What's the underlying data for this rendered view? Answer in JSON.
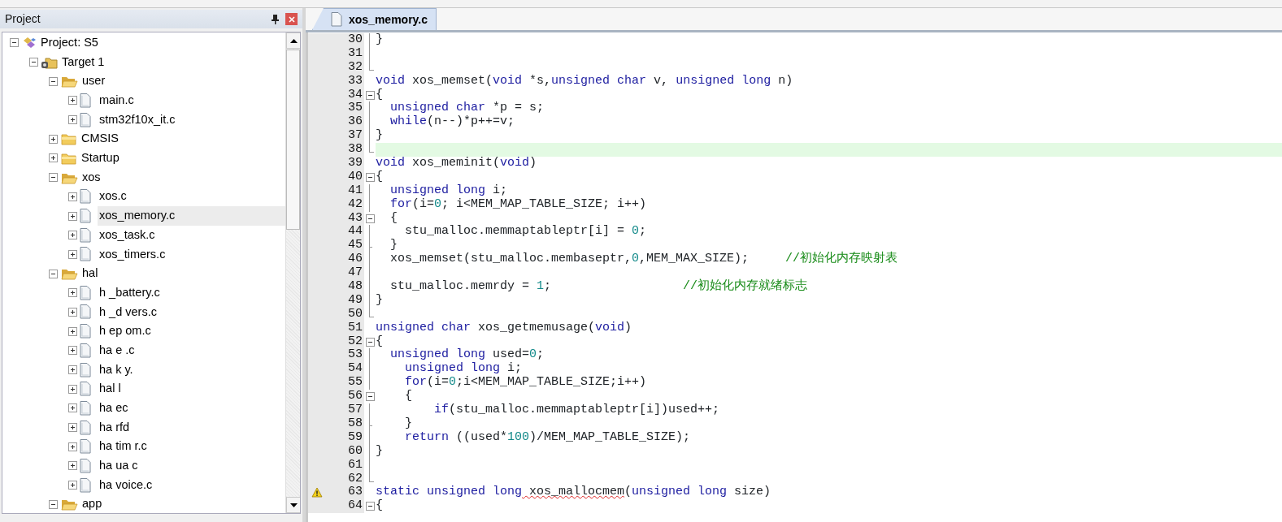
{
  "project_panel": {
    "title": "Project",
    "tree": [
      {
        "label": "Project: S5",
        "kind": "project",
        "expanded": true,
        "selected": false,
        "children": [
          {
            "label": "Target 1",
            "kind": "target",
            "expanded": true,
            "selected": false,
            "children": [
              {
                "label": "user",
                "kind": "folder",
                "expanded": true,
                "selected": false,
                "children": [
                  {
                    "label": "main.c",
                    "kind": "file",
                    "expanded": false,
                    "selected": false
                  },
                  {
                    "label": "stm32f10x_it.c",
                    "kind": "file",
                    "expanded": false,
                    "selected": false
                  }
                ]
              },
              {
                "label": "CMSIS",
                "kind": "folder",
                "expanded": false,
                "selected": false
              },
              {
                "label": "Startup",
                "kind": "folder",
                "expanded": false,
                "selected": false
              },
              {
                "label": "xos",
                "kind": "folder",
                "expanded": true,
                "selected": false,
                "children": [
                  {
                    "label": "xos.c",
                    "kind": "file",
                    "expanded": false,
                    "selected": false
                  },
                  {
                    "label": "xos_memory.c",
                    "kind": "file",
                    "expanded": false,
                    "selected": true
                  },
                  {
                    "label": "xos_task.c",
                    "kind": "file",
                    "expanded": false,
                    "selected": false
                  },
                  {
                    "label": "xos_timers.c",
                    "kind": "file",
                    "expanded": false,
                    "selected": false
                  }
                ]
              },
              {
                "label": "hal",
                "kind": "folder",
                "expanded": true,
                "selected": false,
                "children": [
                  {
                    "label": "h _battery.c",
                    "kind": "file",
                    "expanded": false,
                    "selected": false
                  },
                  {
                    "label": "h _d vers.c",
                    "kind": "file",
                    "expanded": false,
                    "selected": false
                  },
                  {
                    "label": "h ep om.c",
                    "kind": "file",
                    "expanded": false,
                    "selected": false
                  },
                  {
                    "label": "ha e .c",
                    "kind": "file",
                    "expanded": false,
                    "selected": false
                  },
                  {
                    "label": "ha k y.",
                    "kind": "file",
                    "expanded": false,
                    "selected": false
                  },
                  {
                    "label": "hal l",
                    "kind": "file",
                    "expanded": false,
                    "selected": false
                  },
                  {
                    "label": "ha ec",
                    "kind": "file",
                    "expanded": false,
                    "selected": false
                  },
                  {
                    "label": "ha rfd",
                    "kind": "file",
                    "expanded": false,
                    "selected": false
                  },
                  {
                    "label": "ha tim r.c",
                    "kind": "file",
                    "expanded": false,
                    "selected": false
                  },
                  {
                    "label": "ha ua c",
                    "kind": "file",
                    "expanded": false,
                    "selected": false
                  },
                  {
                    "label": "ha voice.c",
                    "kind": "file",
                    "expanded": false,
                    "selected": false
                  }
                ]
              },
              {
                "label": "app",
                "kind": "folder",
                "expanded": true,
                "selected": false
              }
            ]
          }
        ]
      }
    ]
  },
  "editor": {
    "tabs": [
      {
        "label": "xos_memory.c",
        "selected": true
      }
    ],
    "lines": [
      {
        "number": "30",
        "kind": "body",
        "highlighted": false,
        "warning": false,
        "segments": [
          {
            "kind": "plain",
            "text": "}"
          }
        ]
      },
      {
        "number": "31",
        "kind": "body",
        "highlighted": false,
        "warning": false
      },
      {
        "number": "32",
        "kind": "end",
        "highlighted": false,
        "warning": false
      },
      {
        "number": "33",
        "kind": "plain",
        "highlighted": false,
        "warning": false,
        "segments": [
          {
            "kind": "keyword",
            "text": "void"
          },
          {
            "kind": "plain",
            "text": " xos_memset("
          },
          {
            "kind": "keyword",
            "text": "void"
          },
          {
            "kind": "plain",
            "text": " *s,"
          },
          {
            "kind": "keyword",
            "text": "unsigned char"
          },
          {
            "kind": "plain",
            "text": " v, "
          },
          {
            "kind": "keyword",
            "text": "unsigned long"
          },
          {
            "kind": "plain",
            "text": " n)"
          }
        ]
      },
      {
        "number": "34",
        "kind": "start",
        "highlighted": false,
        "warning": false,
        "segments": [
          {
            "kind": "plain",
            "text": "{"
          }
        ]
      },
      {
        "number": "35",
        "kind": "body",
        "highlighted": false,
        "warning": false,
        "segments": [
          {
            "kind": "keyword",
            "text": "  unsigned char"
          },
          {
            "kind": "plain",
            "text": " *p = s;"
          }
        ]
      },
      {
        "number": "36",
        "kind": "body",
        "highlighted": false,
        "warning": false,
        "segments": [
          {
            "kind": "keyword",
            "text": "  while"
          },
          {
            "kind": "plain",
            "text": "(n--)*p++=v;"
          }
        ]
      },
      {
        "number": "37",
        "kind": "body",
        "highlighted": false,
        "warning": false,
        "segments": [
          {
            "kind": "plain",
            "text": "}"
          }
        ]
      },
      {
        "number": "38",
        "kind": "end",
        "highlighted": true,
        "warning": false
      },
      {
        "number": "39",
        "kind": "plain",
        "highlighted": false,
        "warning": false,
        "segments": [
          {
            "kind": "keyword",
            "text": "void"
          },
          {
            "kind": "plain",
            "text": " xos_meminit("
          },
          {
            "kind": "keyword",
            "text": "void"
          },
          {
            "kind": "plain",
            "text": ")"
          }
        ]
      },
      {
        "number": "40",
        "kind": "start",
        "highlighted": false,
        "warning": false,
        "segments": [
          {
            "kind": "plain",
            "text": "{"
          }
        ]
      },
      {
        "number": "41",
        "kind": "body",
        "highlighted": false,
        "warning": false,
        "segments": [
          {
            "kind": "keyword",
            "text": "  unsigned long"
          },
          {
            "kind": "plain",
            "text": " i;"
          }
        ]
      },
      {
        "number": "42",
        "kind": "body",
        "highlighted": false,
        "warning": false,
        "segments": [
          {
            "kind": "keyword",
            "text": "  for"
          },
          {
            "kind": "plain",
            "text": "(i="
          },
          {
            "kind": "number",
            "text": "0"
          },
          {
            "kind": "plain",
            "text": "; i<MEM_MAP_TABLE_SIZE; i++)"
          }
        ]
      },
      {
        "number": "43",
        "kind": "start",
        "highlighted": false,
        "warning": false,
        "segments": [
          {
            "kind": "plain",
            "text": "  {"
          }
        ]
      },
      {
        "number": "44",
        "kind": "body",
        "highlighted": false,
        "warning": false,
        "segments": [
          {
            "kind": "plain",
            "text": "    stu_malloc.memmaptableptr[i] = "
          },
          {
            "kind": "number",
            "text": "0"
          },
          {
            "kind": "plain",
            "text": ";"
          }
        ]
      },
      {
        "number": "45",
        "kind": "tick",
        "highlighted": false,
        "warning": false,
        "segments": [
          {
            "kind": "plain",
            "text": "  }"
          }
        ]
      },
      {
        "number": "46",
        "kind": "body",
        "highlighted": false,
        "warning": false,
        "segments": [
          {
            "kind": "plain",
            "text": "  xos_memset(stu_malloc.membaseptr,"
          },
          {
            "kind": "number",
            "text": "0"
          },
          {
            "kind": "plain",
            "text": ",MEM_MAX_SIZE);"
          },
          {
            "kind": "comment",
            "text": "     //初始化内存映射表"
          }
        ]
      },
      {
        "number": "47",
        "kind": "body",
        "highlighted": false,
        "warning": false
      },
      {
        "number": "48",
        "kind": "body",
        "highlighted": false,
        "warning": false,
        "segments": [
          {
            "kind": "plain",
            "text": "  stu_malloc.memrdy = "
          },
          {
            "kind": "number",
            "text": "1"
          },
          {
            "kind": "plain",
            "text": ";"
          },
          {
            "kind": "comment",
            "text": "                  //初始化内存就绪标志"
          }
        ]
      },
      {
        "number": "49",
        "kind": "body",
        "highlighted": false,
        "warning": false,
        "segments": [
          {
            "kind": "plain",
            "text": "}"
          }
        ]
      },
      {
        "number": "50",
        "kind": "end",
        "highlighted": false,
        "warning": false
      },
      {
        "number": "51",
        "kind": "plain",
        "highlighted": false,
        "warning": false,
        "segments": [
          {
            "kind": "keyword",
            "text": "unsigned char"
          },
          {
            "kind": "plain",
            "text": " xos_getmemusage("
          },
          {
            "kind": "keyword",
            "text": "void"
          },
          {
            "kind": "plain",
            "text": ")"
          }
        ]
      },
      {
        "number": "52",
        "kind": "start",
        "highlighted": false,
        "warning": false,
        "segments": [
          {
            "kind": "plain",
            "text": "{"
          }
        ]
      },
      {
        "number": "53",
        "kind": "body",
        "highlighted": false,
        "warning": false,
        "segments": [
          {
            "kind": "keyword",
            "text": "  unsigned long"
          },
          {
            "kind": "plain",
            "text": " used="
          },
          {
            "kind": "number",
            "text": "0"
          },
          {
            "kind": "plain",
            "text": ";"
          }
        ]
      },
      {
        "number": "54",
        "kind": "body",
        "highlighted": false,
        "warning": false,
        "segments": [
          {
            "kind": "keyword",
            "text": "    unsigned long"
          },
          {
            "kind": "plain",
            "text": " i;"
          }
        ]
      },
      {
        "number": "55",
        "kind": "body",
        "highlighted": false,
        "warning": false,
        "segments": [
          {
            "kind": "keyword",
            "text": "    for"
          },
          {
            "kind": "plain",
            "text": "(i="
          },
          {
            "kind": "number",
            "text": "0"
          },
          {
            "kind": "plain",
            "text": ";i<MEM_MAP_TABLE_SIZE;i++)"
          }
        ]
      },
      {
        "number": "56",
        "kind": "start",
        "highlighted": false,
        "warning": false,
        "segments": [
          {
            "kind": "plain",
            "text": "    {"
          }
        ]
      },
      {
        "number": "57",
        "kind": "body",
        "highlighted": false,
        "warning": false,
        "segments": [
          {
            "kind": "keyword",
            "text": "        if"
          },
          {
            "kind": "plain",
            "text": "(stu_malloc.memmaptableptr[i])used++;"
          }
        ]
      },
      {
        "number": "58",
        "kind": "tick",
        "highlighted": false,
        "warning": false,
        "segments": [
          {
            "kind": "plain",
            "text": "    }"
          }
        ]
      },
      {
        "number": "59",
        "kind": "body",
        "highlighted": false,
        "warning": false,
        "segments": [
          {
            "kind": "keyword",
            "text": "    return"
          },
          {
            "kind": "plain",
            "text": " ((used*"
          },
          {
            "kind": "number",
            "text": "100"
          },
          {
            "kind": "plain",
            "text": ")/MEM_MAP_TABLE_SIZE);"
          }
        ]
      },
      {
        "number": "60",
        "kind": "body",
        "highlighted": false,
        "warning": false,
        "segments": [
          {
            "kind": "plain",
            "text": "}"
          }
        ]
      },
      {
        "number": "61",
        "kind": "body",
        "highlighted": false,
        "warning": false
      },
      {
        "number": "62",
        "kind": "end",
        "highlighted": false,
        "warning": false
      },
      {
        "number": "63",
        "kind": "plain",
        "highlighted": false,
        "warning": true,
        "segments": [
          {
            "kind": "keyword",
            "text": "static unsigned long"
          },
          {
            "kind": "error",
            "text": " xos_mallocmem"
          },
          {
            "kind": "plain",
            "text": "("
          },
          {
            "kind": "keyword",
            "text": "unsigned long"
          },
          {
            "kind": "plain",
            "text": " size)"
          }
        ]
      },
      {
        "number": "64",
        "kind": "start",
        "highlighted": false,
        "warning": false,
        "segments": [
          {
            "kind": "plain",
            "text": "{"
          }
        ]
      }
    ]
  }
}
